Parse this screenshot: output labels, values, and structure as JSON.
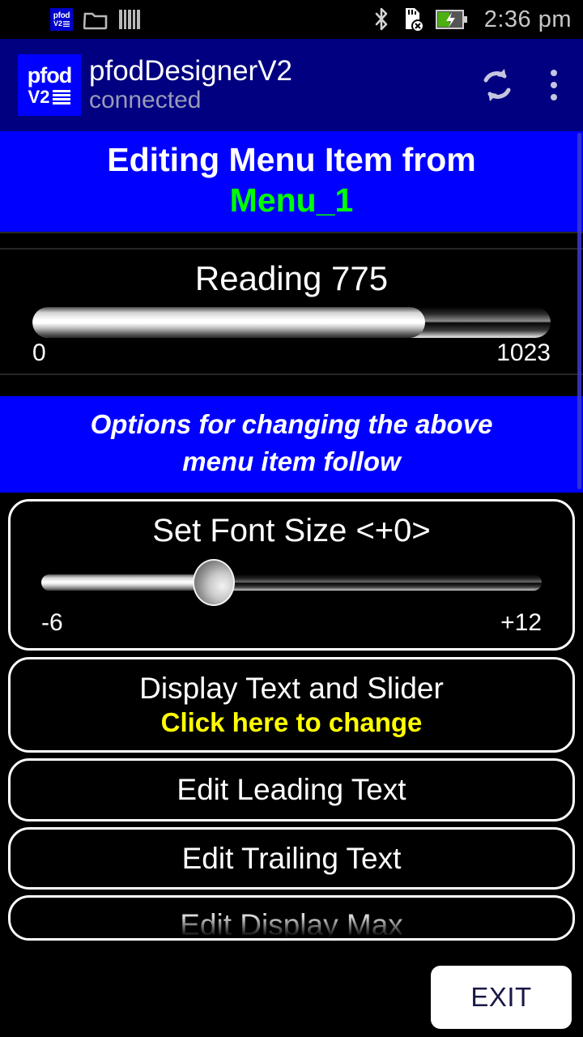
{
  "status_bar": {
    "icons": [
      "pfod-app-icon",
      "folder-icon",
      "barcode-icon",
      "bluetooth-icon",
      "sdcard-removed-icon",
      "battery-charging-icon"
    ],
    "clock": "2:36 pm",
    "logo_top": "pfod",
    "logo_bottom": "V2"
  },
  "app_bar": {
    "logo_top": "pfod",
    "logo_bottom": "V2",
    "title": "pfodDesignerV2",
    "subtitle": "connected",
    "refresh_icon": "refresh-icon",
    "overflow_icon": "overflow-menu-icon"
  },
  "header_banner": {
    "line1": "Editing Menu Item from",
    "line2": "Menu_1",
    "bg_color": "#0000FF",
    "line2_color": "#00FF00"
  },
  "reading": {
    "label": "Reading 775",
    "value": 775,
    "min_label": "0",
    "max_label": "1023",
    "min": 0,
    "max": 1023,
    "percent": 75.8
  },
  "options_banner": {
    "line1": "Options for changing the above",
    "line2": "menu item follow"
  },
  "font_size_slider": {
    "title": "Set Font Size <+0>",
    "value": 0,
    "min_label": "-6",
    "max_label": "+12",
    "min": -6,
    "max": 12,
    "percent": 34.5
  },
  "menu_buttons": [
    {
      "main": "Display Text and Slider",
      "sub": "Click here to change",
      "sub_color": "#FFFF00"
    },
    {
      "main": "Edit Leading Text",
      "sub": "",
      "sub_color": ""
    },
    {
      "main": "Edit Trailing Text",
      "sub": "",
      "sub_color": ""
    },
    {
      "main": "Edit Display Max",
      "sub": "",
      "sub_color": ""
    }
  ],
  "exit_button": {
    "label": "EXIT",
    "text_color": "#181848",
    "bg_color": "#FFFFFF"
  }
}
